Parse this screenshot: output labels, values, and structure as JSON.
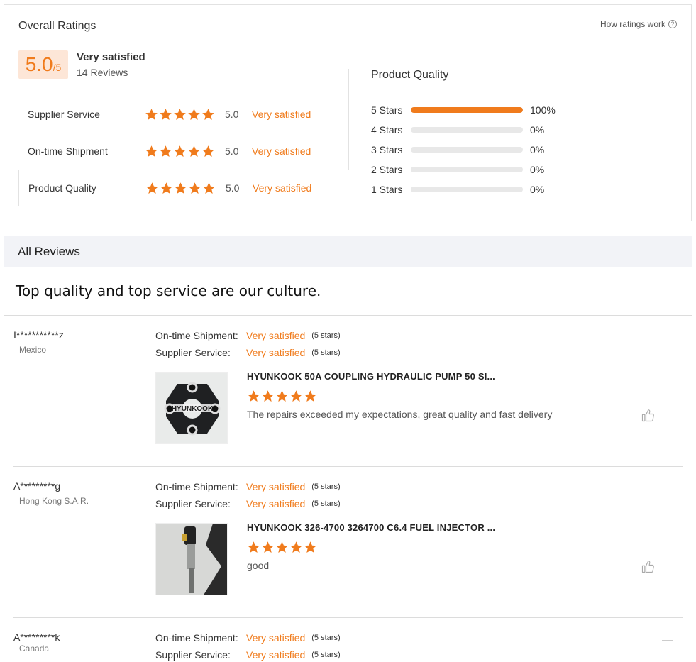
{
  "ratings": {
    "title": "Overall Ratings",
    "how_ratings_work": "How ratings work",
    "help_icon": "?",
    "score": "5.0",
    "score_max": "/5",
    "level": "Very satisfied",
    "reviews_count": "14 Reviews",
    "accent_color": "#f07b1c",
    "dimensions": [
      {
        "label": "Supplier Service",
        "stars": 5,
        "score": "5.0",
        "level": "Very satisfied"
      },
      {
        "label": "On-time Shipment",
        "stars": 5,
        "score": "5.0",
        "level": "Very satisfied"
      },
      {
        "label": "Product Quality",
        "stars": 5,
        "score": "5.0",
        "level": "Very satisfied",
        "selected": true
      }
    ]
  },
  "product_quality": {
    "title": "Product Quality",
    "distribution": [
      {
        "label": "5  Stars",
        "percent": 100,
        "text": "100%"
      },
      {
        "label": "4  Stars",
        "percent": 0,
        "text": "0%"
      },
      {
        "label": "3  Stars",
        "percent": 0,
        "text": "0%"
      },
      {
        "label": "2  Stars",
        "percent": 0,
        "text": "0%"
      },
      {
        "label": "1  Stars",
        "percent": 0,
        "text": "0%"
      }
    ]
  },
  "all_reviews": {
    "title": "All Reviews",
    "slogan": "Top quality and top service are our culture."
  },
  "reviews": [
    {
      "name": "I***********z",
      "country": "Mexico",
      "shipment_label": "On-time Shipment:",
      "shipment_value": "Very satisfied",
      "shipment_stars": "(5 stars)",
      "service_label": "Supplier Service:",
      "service_value": "Very satisfied",
      "service_stars": "(5 stars)",
      "product": "HYUNKOOK 50A COUPLING HYDRAULIC PUMP 50 SI...",
      "product_stars": 5,
      "comment": "The repairs exceeded my expectations, great quality and fast delivery",
      "thumb_text": "HYUNKOOK",
      "thumb_icon": "coupling-product-image"
    },
    {
      "name": "A*********g",
      "country": "Hong Kong S.A.R.",
      "shipment_label": "On-time Shipment:",
      "shipment_value": "Very satisfied",
      "shipment_stars": "(5 stars)",
      "service_label": "Supplier Service:",
      "service_value": "Very satisfied",
      "service_stars": "(5 stars)",
      "product": "HYUNKOOK 326-4700 3264700 C6.4 FUEL INJECTOR ...",
      "product_stars": 5,
      "comment": "good",
      "thumb_icon": "injector-product-image"
    },
    {
      "name": "A*********k",
      "country": "Canada",
      "shipment_label": "On-time Shipment:",
      "shipment_value": "Very satisfied",
      "shipment_stars": "(5 stars)",
      "service_label": "Supplier Service:",
      "service_value": "Very satisfied",
      "service_stars": "(5 stars)"
    }
  ]
}
